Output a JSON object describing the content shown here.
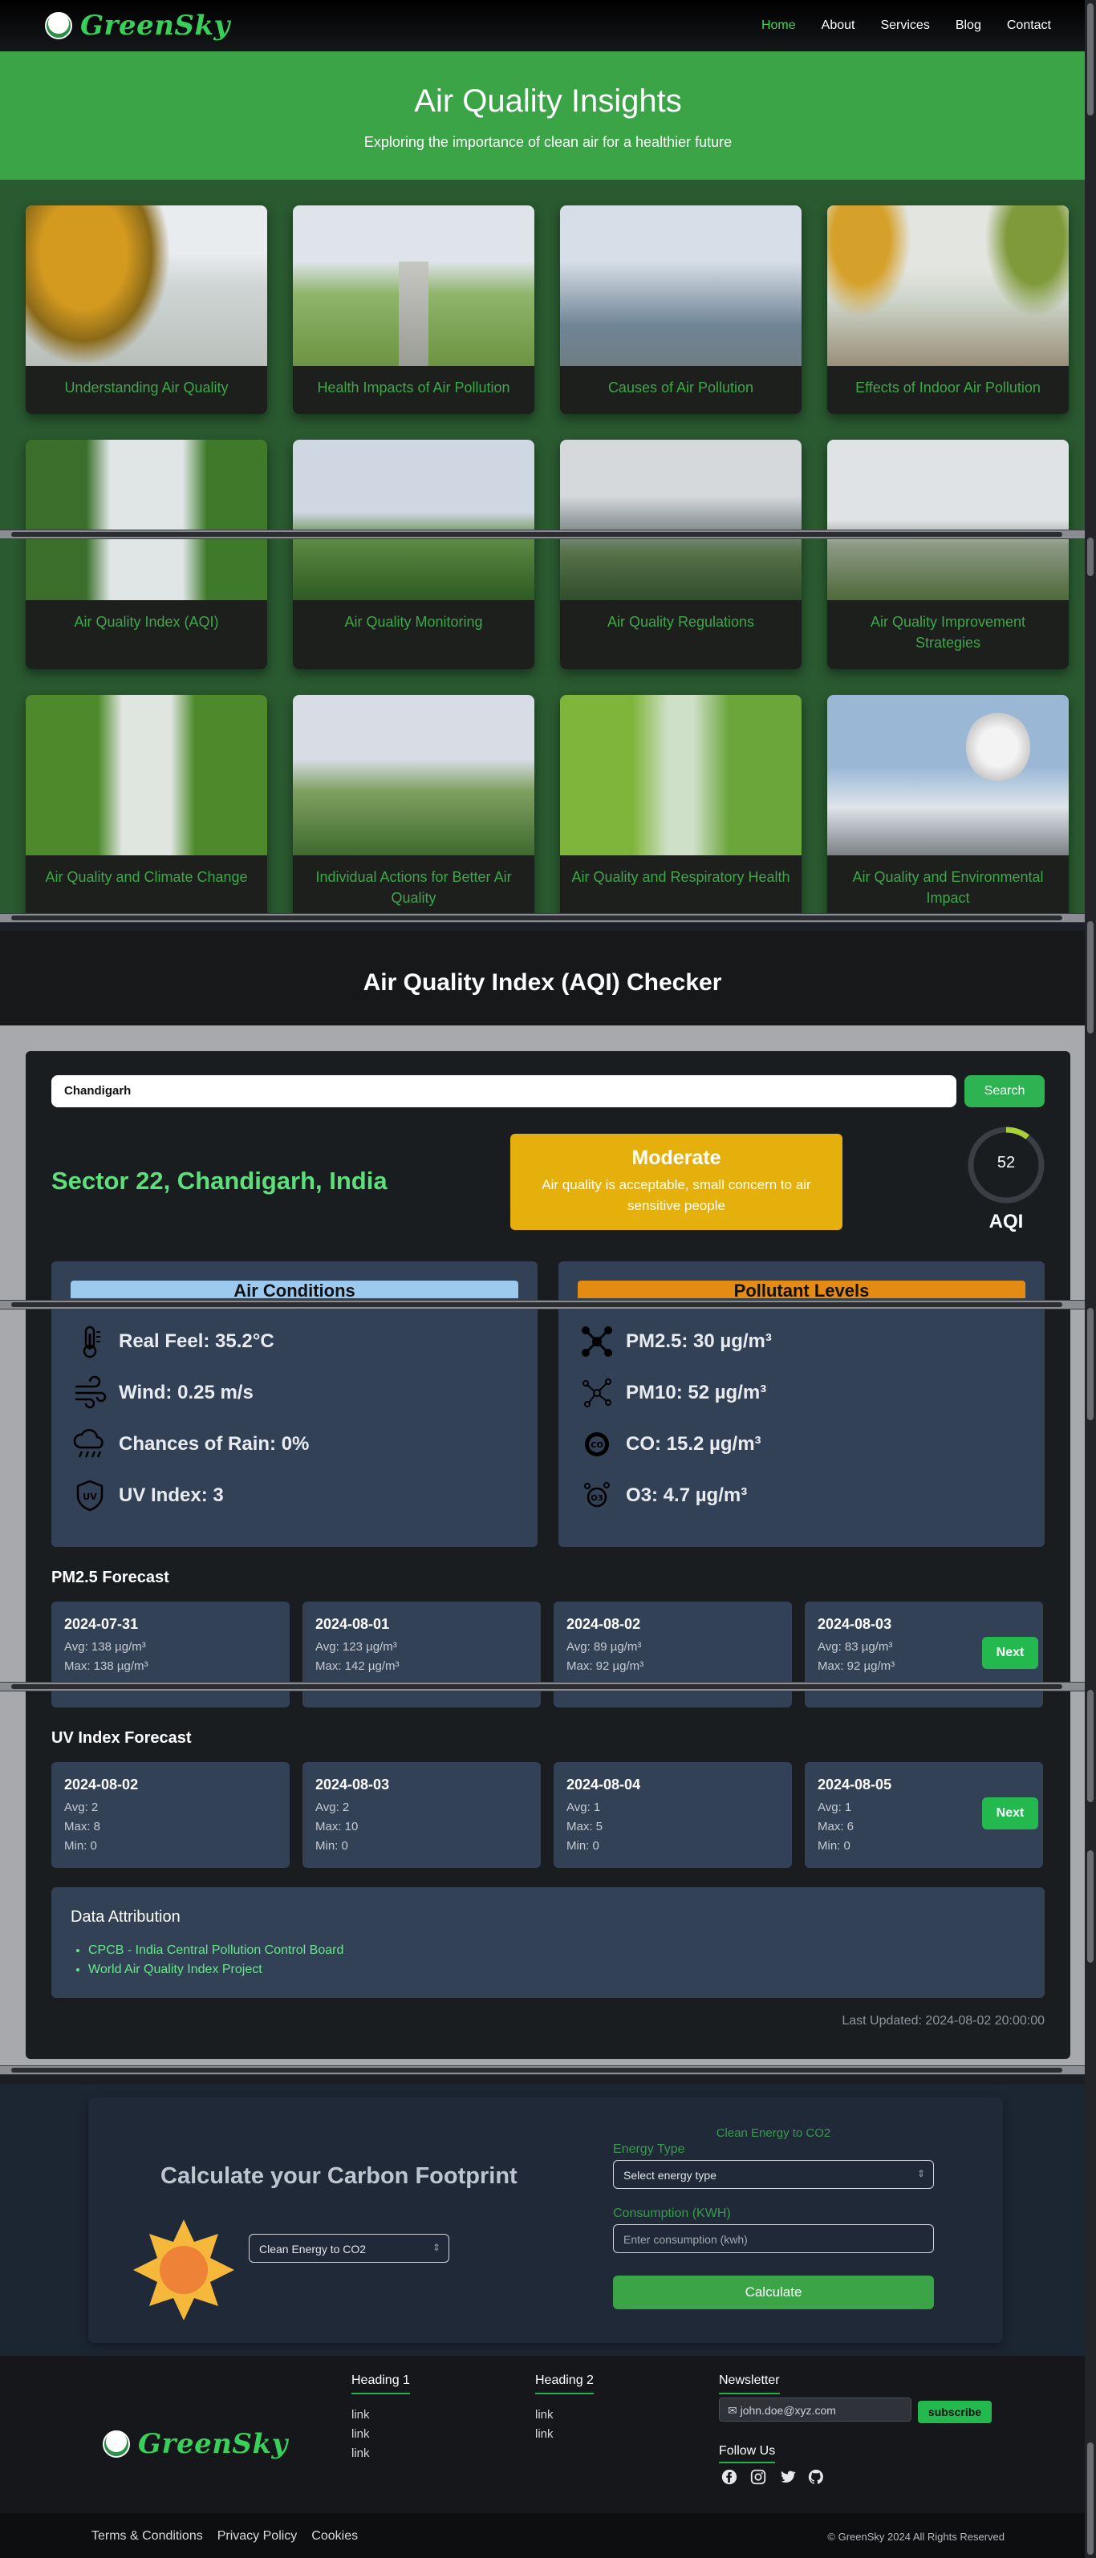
{
  "nav": {
    "brand": "GreenSky",
    "links": [
      "Home",
      "About",
      "Services",
      "Blog",
      "Contact"
    ]
  },
  "hero": {
    "title": "Air Quality Insights",
    "subtitle": "Exploring the importance of clean air for a healthier future"
  },
  "cards": [
    "Understanding Air Quality",
    "Health Impacts of Air Pollution",
    "Causes of Air Pollution",
    "Effects of Indoor Air Pollution",
    "Air Quality Index (AQI)",
    "Air Quality Monitoring",
    "Air Quality Regulations",
    "Air Quality Improvement Strategies",
    "Air Quality and Climate Change",
    "Individual Actions for Better Air Quality",
    "Air Quality and Respiratory Health",
    "Air Quality and Environmental Impact"
  ],
  "aqi": {
    "section_title": "Air Quality Index (AQI) Checker",
    "search_value": "Chandigarh",
    "search_button": "Search",
    "location": "Sector 22, Chandigarh, India",
    "status": "Moderate",
    "status_desc": "Air quality is acceptable, small concern to air sensitive people",
    "value": "52",
    "value_num": 52,
    "label": "AQI",
    "air_conditions": {
      "title": "Air Conditions",
      "items": [
        "Real Feel: 35.2°C",
        "Wind: 0.25 m/s",
        "Chances of Rain: 0%",
        "UV Index: 3"
      ]
    },
    "pollutants": {
      "title": "Pollutant Levels",
      "items": [
        "PM2.5: 30 µg/m³",
        "PM10: 52 µg/m³",
        "CO: 15.2 µg/m³",
        "O3: 4.7 µg/m³"
      ]
    },
    "pm25_forecast": {
      "title": "PM2.5 Forecast",
      "days": [
        {
          "date": "2024-07-31",
          "avg": "Avg: 138 µg/m³",
          "max": "Max: 138 µg/m³"
        },
        {
          "date": "2024-08-01",
          "avg": "Avg: 123 µg/m³",
          "max": "Max: 142 µg/m³"
        },
        {
          "date": "2024-08-02",
          "avg": "Avg: 89 µg/m³",
          "max": "Max: 92 µg/m³"
        },
        {
          "date": "2024-08-03",
          "avg": "Avg: 83 µg/m³",
          "max": "Max: 92 µg/m³"
        }
      ]
    },
    "uv_forecast": {
      "title": "UV Index Forecast",
      "days": [
        {
          "date": "2024-08-02",
          "avg": "Avg: 2",
          "max": "Max: 8",
          "min": "Min: 0"
        },
        {
          "date": "2024-08-03",
          "avg": "Avg: 2",
          "max": "Max: 10",
          "min": "Min: 0"
        },
        {
          "date": "2024-08-04",
          "avg": "Avg: 1",
          "max": "Max: 5",
          "min": "Min: 0"
        },
        {
          "date": "2024-08-05",
          "avg": "Avg: 1",
          "max": "Max: 6",
          "min": "Min: 0"
        }
      ]
    },
    "next_label": "Next",
    "attribution": {
      "title": "Data Attribution",
      "links": [
        "CPCB - India Central Pollution Control Board",
        "World Air Quality Index Project"
      ]
    },
    "last_updated": "Last Updated: 2024-08-02 20:00:00"
  },
  "carbon": {
    "title": "Calculate your Carbon Footprint",
    "left_select": "Clean Energy to CO2",
    "form_heading": "Clean Energy to CO2",
    "energy_label": "Energy Type",
    "energy_select": "Select energy type",
    "consumption_label": "Consumption (KWH)",
    "consumption_placeholder": "Enter consumption (kwh)",
    "button": "Calculate"
  },
  "footer": {
    "brand": "GreenSky",
    "heading1": "Heading 1",
    "heading1_links": [
      "link",
      "link",
      "link"
    ],
    "heading2": "Heading 2",
    "heading2_links": [
      "link",
      "link"
    ],
    "newsletter": "Newsletter",
    "email_placeholder": "john.doe@xyz.com",
    "subscribe": "subscribe",
    "follow": "Follow Us",
    "bottom_links": [
      "Terms & Conditions",
      "Privacy Policy",
      "Cookies"
    ],
    "copyright": "© GreenSky 2024 All Rights Reserved"
  },
  "colors": {
    "brand_green": "#3aa447",
    "accent_green": "#23b94f",
    "moderate": "#e6b00c",
    "panel": "#334156"
  }
}
